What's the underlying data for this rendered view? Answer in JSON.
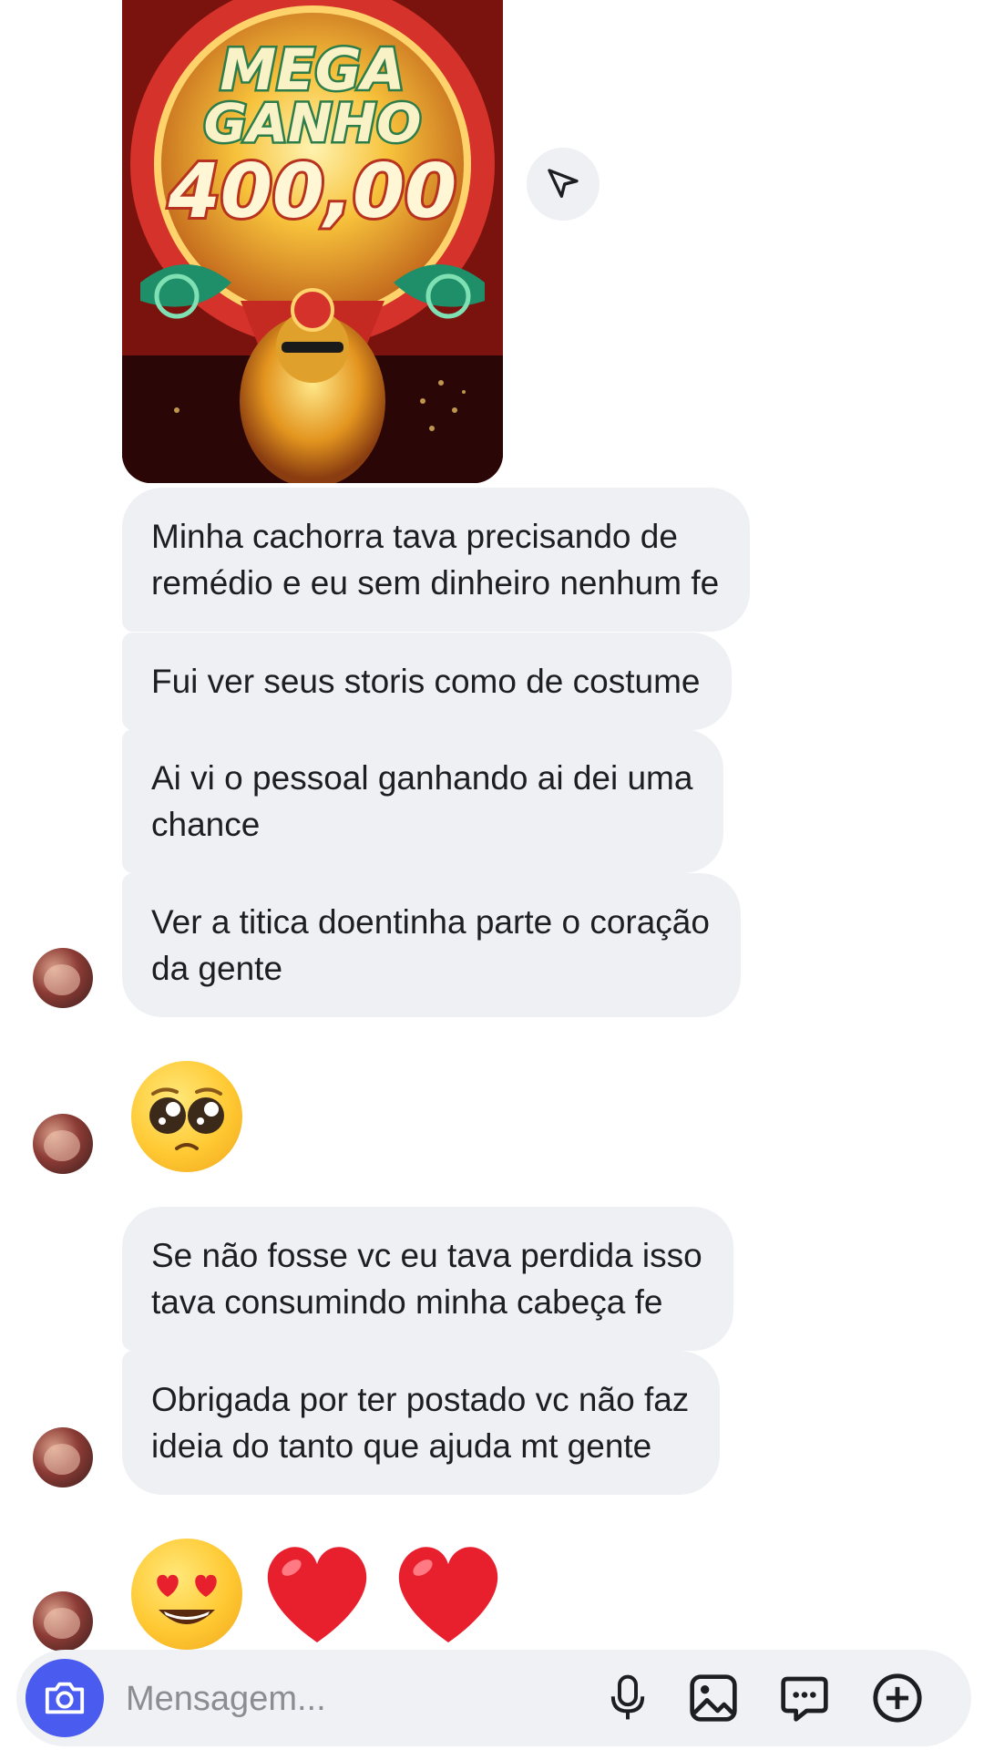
{
  "shared_post": {
    "title_line1": "MEGA",
    "title_line2": "GANHO",
    "amount": "400,00"
  },
  "messages": [
    {
      "text_line1": "Minha cachorra tava precisando de",
      "text_line2": "remédio e eu sem dinheiro nenhum fe"
    },
    {
      "text_line1": "Fui ver seus storis como de costume"
    },
    {
      "text_line1": "Ai vi o pessoal ganhando ai dei uma",
      "text_line2": "chance"
    },
    {
      "text_line1": "Ver a titica doentinha parte o coração",
      "text_line2": "da gente"
    },
    {
      "emoji": "pleading-face"
    },
    {
      "text_line1": "Se não fosse vc eu tava perdida isso",
      "text_line2": "tava consumindo minha cabeça fe"
    },
    {
      "text_line1": "Obrigada por ter postado vc não faz",
      "text_line2": "ideia do tanto que ajuda mt gente"
    },
    {
      "emoji": "smiling-face-with-heart-eyes red-heart red-heart"
    }
  ],
  "composer": {
    "placeholder": "Mensagem...",
    "icons": [
      "camera-icon",
      "microphone-icon",
      "gallery-icon",
      "sticker-icon",
      "plus-icon"
    ]
  },
  "colors": {
    "bubble": "#eef0f3",
    "text": "#1c1e21",
    "camera_button": "#4a5bf0",
    "heart": "#e8202e"
  }
}
